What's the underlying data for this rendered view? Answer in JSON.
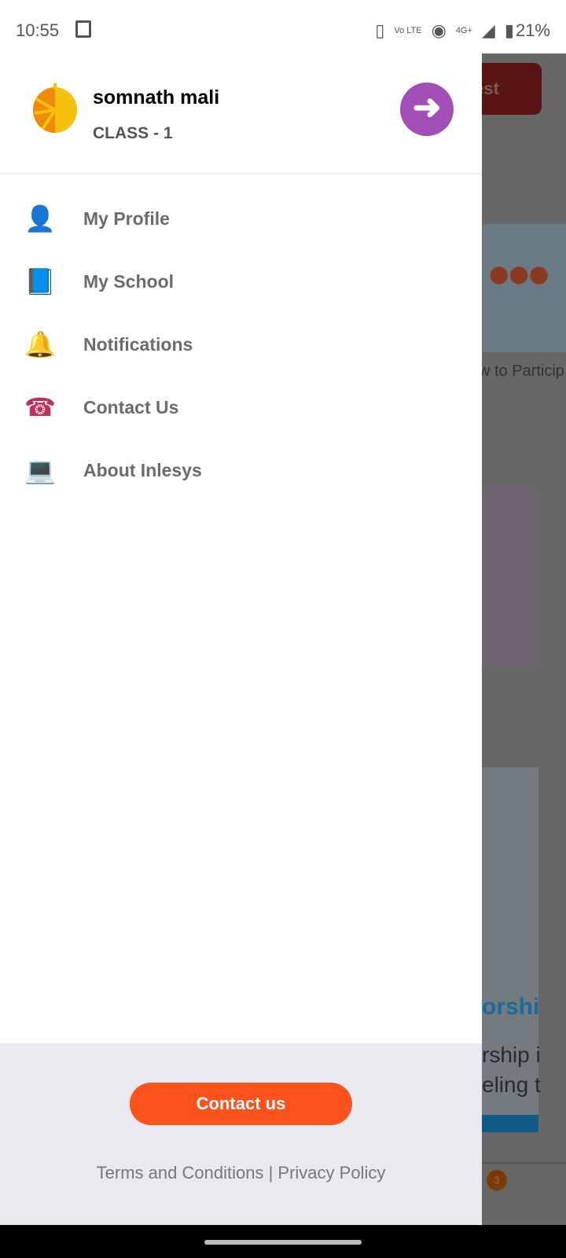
{
  "status_bar": {
    "time": "10:55",
    "network": "4G+",
    "volte": "Vo LTE",
    "battery": "21%"
  },
  "background": {
    "button_partial": "est",
    "caption_partial": "w to Particip",
    "title_partial": "orshi",
    "text_line1": "rship i",
    "text_line2": "eling t",
    "badge_count": "3"
  },
  "drawer": {
    "user_name": "somnath mali",
    "user_class": "CLASS - 1",
    "menu": [
      {
        "label": "My Profile",
        "icon": "profile-add-icon"
      },
      {
        "label": "My School",
        "icon": "school-book-icon"
      },
      {
        "label": "Notifications",
        "icon": "bell-icon"
      },
      {
        "label": "Contact Us",
        "icon": "phone-icon"
      },
      {
        "label": "About Inlesys",
        "icon": "laptop-icon"
      }
    ],
    "footer": {
      "contact_button": "Contact us",
      "terms": "Terms and Conditions",
      "separator": " | ",
      "privacy": "Privacy Policy"
    }
  },
  "colors": {
    "accent_purple": "#a14fb6",
    "contact_orange": "#fc521c",
    "footer_bg": "#eae9ef"
  }
}
